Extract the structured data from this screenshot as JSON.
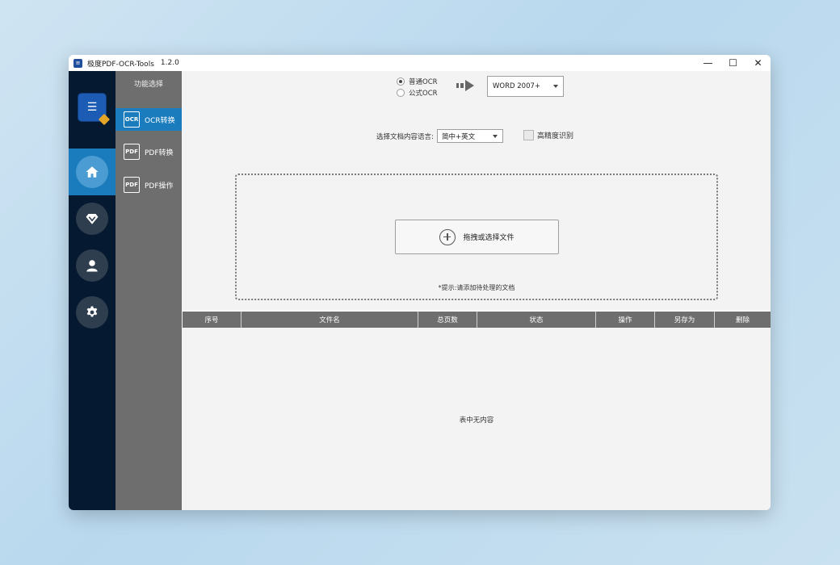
{
  "window": {
    "title": "极度PDF-OCR-Tools",
    "version": "1.2.0",
    "controls": {
      "minimize": "—",
      "maximize": "☐",
      "close": "✕"
    }
  },
  "nav": {
    "items": [
      {
        "icon": "home-icon",
        "active": true
      },
      {
        "icon": "diamond-icon",
        "active": false
      },
      {
        "icon": "user-icon",
        "active": false
      },
      {
        "icon": "gear-icon",
        "active": false
      }
    ]
  },
  "submenu": {
    "title": "功能选择",
    "items": [
      {
        "label": "OCR转换",
        "icon_text": "OCR",
        "active": true
      },
      {
        "label": "PDF转换",
        "icon_text": "PDF",
        "active": false
      },
      {
        "label": "PDF操作",
        "icon_text": "PDF",
        "active": false
      }
    ]
  },
  "ocr_mode": {
    "options": [
      "普通OCR",
      "公式OCR"
    ],
    "selected": "普通OCR"
  },
  "output_format": {
    "value": "WORD 2007+"
  },
  "language": {
    "label": "选择文档内容语言:",
    "value": "简中+英文"
  },
  "high_precision": {
    "label": "高精度识别",
    "checked": false
  },
  "dropzone": {
    "button_label": "拖拽或选择文件",
    "hint": "*提示:请添加待处理的文档"
  },
  "table": {
    "columns": [
      "序号",
      "文件名",
      "总页数",
      "状态",
      "操作",
      "另存为",
      "删除"
    ],
    "empty_text": "表中无内容"
  },
  "colors": {
    "accent": "#1a7cbd",
    "nav_bg": "#051a31",
    "submenu_bg": "#6e6e6e"
  }
}
